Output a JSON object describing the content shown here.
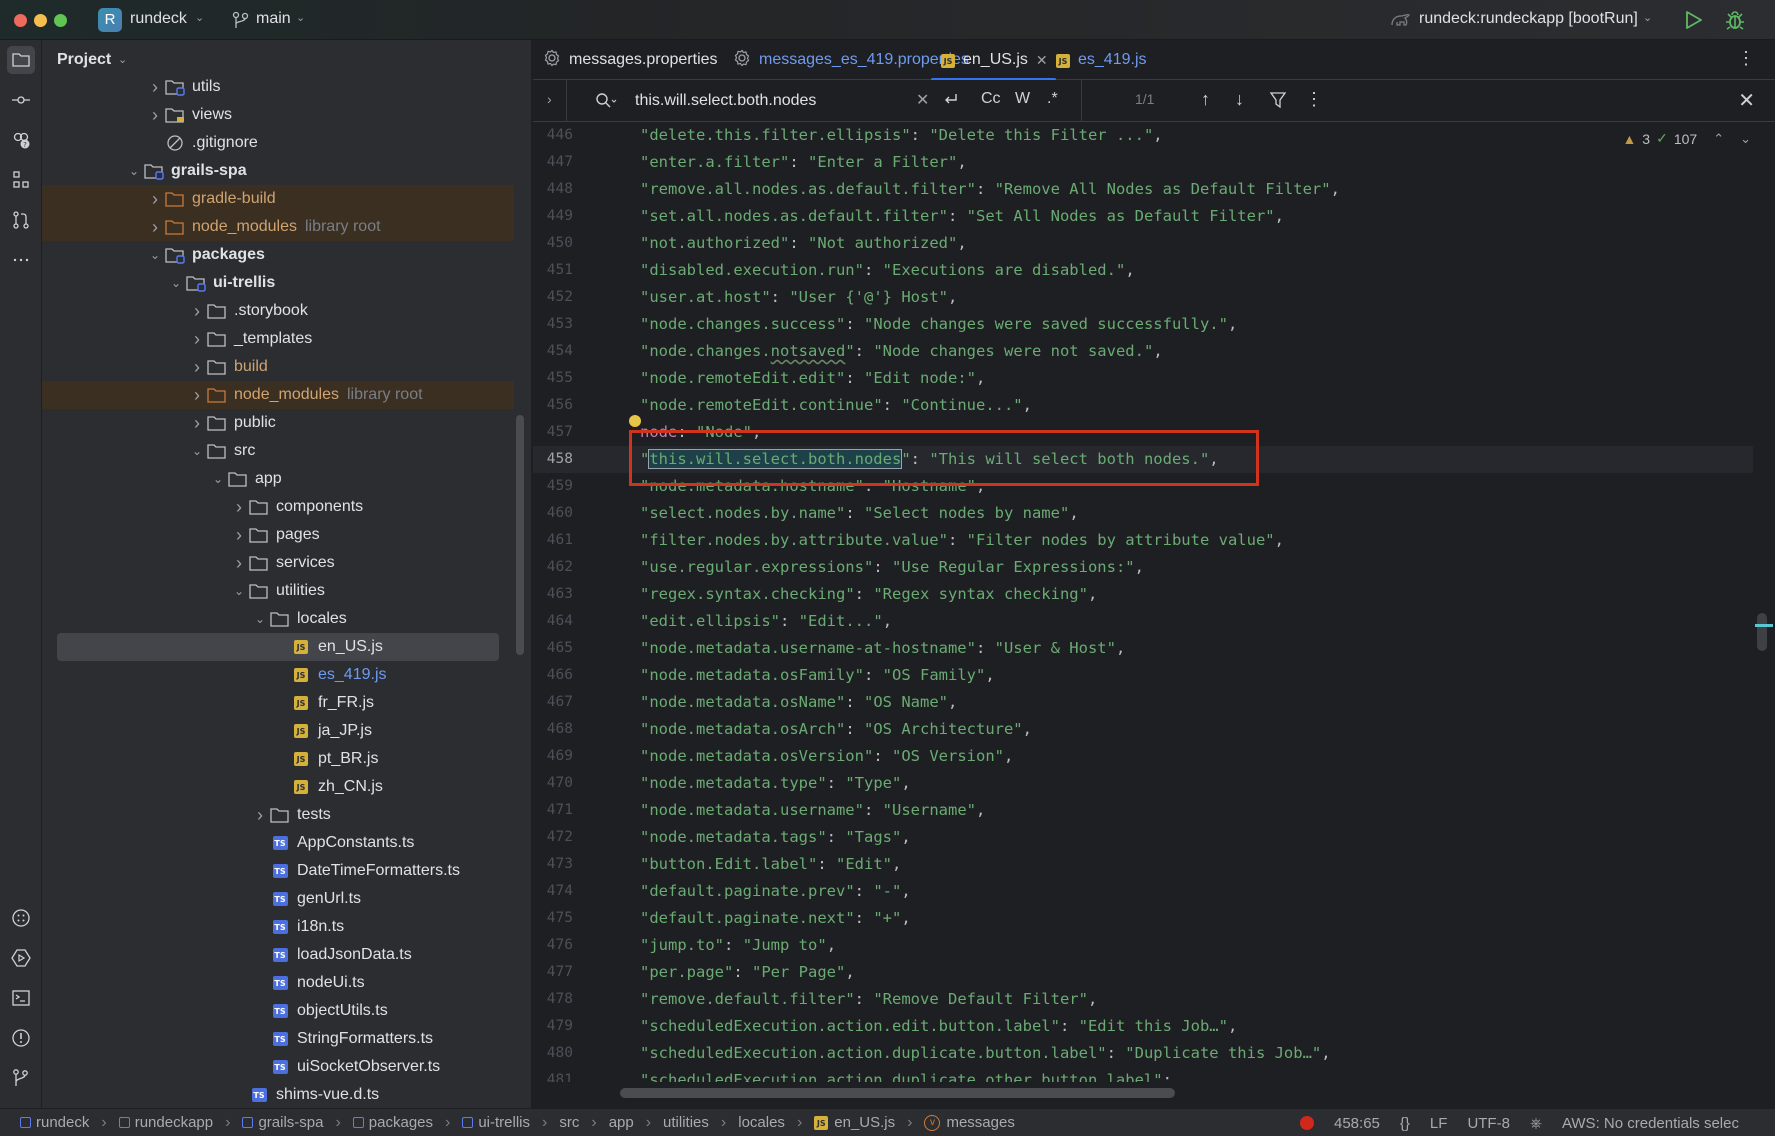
{
  "titlebar": {
    "project_initial": "R",
    "project_name": "rundeck",
    "branch": "main",
    "run_config": "rundeck:rundeckapp [bootRun]"
  },
  "colors": {
    "accent": "#3574f0",
    "string": "#6aab73",
    "highlight_box": "#d0341c",
    "library_root_bg": "#3a2f21",
    "run_green": "#5fb865"
  },
  "project_panel": {
    "title": "Project",
    "tree": [
      {
        "label": "utils",
        "indent": 4,
        "arrow": ">",
        "icon": "module-folder-icon",
        "style": ""
      },
      {
        "label": "views",
        "indent": 4,
        "arrow": ">",
        "icon": "views-folder-icon",
        "style": ""
      },
      {
        "label": ".gitignore",
        "indent": 4,
        "arrow": "",
        "icon": "ignore-file-icon",
        "style": ""
      },
      {
        "label": "grails-spa",
        "indent": 3,
        "arrow": "v",
        "icon": "module-folder-icon",
        "style": "bold"
      },
      {
        "label": "gradle-build",
        "indent": 4,
        "arrow": ">",
        "icon": "excluded-folder-icon",
        "style": "orange",
        "lib": true
      },
      {
        "label": "node_modules",
        "hint": "library root",
        "indent": 4,
        "arrow": ">",
        "icon": "excluded-folder-icon",
        "style": "orange",
        "lib": true
      },
      {
        "label": "packages",
        "indent": 4,
        "arrow": "v",
        "icon": "module-folder-icon",
        "style": "bold"
      },
      {
        "label": "ui-trellis",
        "indent": 5,
        "arrow": "v",
        "icon": "module-folder-icon",
        "style": "bold"
      },
      {
        "label": ".storybook",
        "indent": 6,
        "arrow": ">",
        "icon": "folder-icon",
        "style": ""
      },
      {
        "label": "_templates",
        "indent": 6,
        "arrow": ">",
        "icon": "folder-icon",
        "style": ""
      },
      {
        "label": "build",
        "indent": 6,
        "arrow": ">",
        "icon": "folder-icon",
        "style": "orange"
      },
      {
        "label": "node_modules",
        "hint": "library root",
        "indent": 6,
        "arrow": ">",
        "icon": "excluded-folder-icon",
        "style": "orange",
        "lib": true
      },
      {
        "label": "public",
        "indent": 6,
        "arrow": ">",
        "icon": "folder-icon",
        "style": ""
      },
      {
        "label": "src",
        "indent": 6,
        "arrow": "v",
        "icon": "folder-icon",
        "style": ""
      },
      {
        "label": "app",
        "indent": 7,
        "arrow": "v",
        "icon": "folder-icon",
        "style": ""
      },
      {
        "label": "components",
        "indent": 8,
        "arrow": ">",
        "icon": "folder-icon",
        "style": ""
      },
      {
        "label": "pages",
        "indent": 8,
        "arrow": ">",
        "icon": "folder-icon",
        "style": ""
      },
      {
        "label": "services",
        "indent": 8,
        "arrow": ">",
        "icon": "folder-icon",
        "style": ""
      },
      {
        "label": "utilities",
        "indent": 8,
        "arrow": "v",
        "icon": "folder-icon",
        "style": ""
      },
      {
        "label": "locales",
        "indent": 9,
        "arrow": "v",
        "icon": "folder-icon",
        "style": ""
      },
      {
        "label": "en_US.js",
        "indent": 10,
        "arrow": "",
        "icon": "js-file-icon",
        "style": "",
        "selected": true
      },
      {
        "label": "es_419.js",
        "indent": 10,
        "arrow": "",
        "icon": "js-file-icon",
        "style": "blue"
      },
      {
        "label": "fr_FR.js",
        "indent": 10,
        "arrow": "",
        "icon": "js-file-icon",
        "style": ""
      },
      {
        "label": "ja_JP.js",
        "indent": 10,
        "arrow": "",
        "icon": "js-file-icon",
        "style": ""
      },
      {
        "label": "pt_BR.js",
        "indent": 10,
        "arrow": "",
        "icon": "js-file-icon",
        "style": ""
      },
      {
        "label": "zh_CN.js",
        "indent": 10,
        "arrow": "",
        "icon": "js-file-icon",
        "style": ""
      },
      {
        "label": "tests",
        "indent": 9,
        "arrow": ">",
        "icon": "folder-icon",
        "style": ""
      },
      {
        "label": "AppConstants.ts",
        "indent": 9,
        "arrow": "",
        "icon": "ts-file-icon",
        "style": ""
      },
      {
        "label": "DateTimeFormatters.ts",
        "indent": 9,
        "arrow": "",
        "icon": "ts-file-icon",
        "style": ""
      },
      {
        "label": "genUrl.ts",
        "indent": 9,
        "arrow": "",
        "icon": "ts-file-icon",
        "style": ""
      },
      {
        "label": "i18n.ts",
        "indent": 9,
        "arrow": "",
        "icon": "ts-file-icon",
        "style": ""
      },
      {
        "label": "loadJsonData.ts",
        "indent": 9,
        "arrow": "",
        "icon": "ts-file-icon",
        "style": ""
      },
      {
        "label": "nodeUi.ts",
        "indent": 9,
        "arrow": "",
        "icon": "ts-file-icon",
        "style": ""
      },
      {
        "label": "objectUtils.ts",
        "indent": 9,
        "arrow": "",
        "icon": "ts-file-icon",
        "style": ""
      },
      {
        "label": "StringFormatters.ts",
        "indent": 9,
        "arrow": "",
        "icon": "ts-file-icon",
        "style": ""
      },
      {
        "label": "uiSocketObserver.ts",
        "indent": 9,
        "arrow": "",
        "icon": "ts-file-icon",
        "style": ""
      },
      {
        "label": "shims-vue.d.ts",
        "indent": 8,
        "arrow": "",
        "icon": "ts-file-icon",
        "style": ""
      }
    ]
  },
  "tabs": [
    {
      "label": "messages.properties",
      "icon": "gear-icon",
      "color": "normal",
      "active": false
    },
    {
      "label": "messages_es_419.properties",
      "icon": "gear-icon",
      "color": "blue",
      "active": false
    },
    {
      "label": "en_US.js",
      "icon": "js-file-icon",
      "color": "normal",
      "active": true,
      "closable": true
    },
    {
      "label": "es_419.js",
      "icon": "js-file-icon",
      "color": "blue",
      "active": false
    }
  ],
  "find": {
    "query": "this.will.select.both.nodes",
    "options": [
      "Cc",
      "W",
      ".*"
    ],
    "result_count": "1/1"
  },
  "inspections": {
    "warnings": "3",
    "ok": "107"
  },
  "code": {
    "current_line": 458,
    "lines": [
      {
        "n": 446,
        "key": "delete.this.filter.ellipsis",
        "value": "Delete this Filter ..."
      },
      {
        "n": 447,
        "key": "enter.a.filter",
        "value": "Enter a Filter"
      },
      {
        "n": 448,
        "key": "remove.all.nodes.as.default.filter",
        "value": "Remove All Nodes as Default Filter"
      },
      {
        "n": 449,
        "key": "set.all.nodes.as.default.filter",
        "value": "Set All Nodes as Default Filter"
      },
      {
        "n": 450,
        "key": "not.authorized",
        "value": "Not authorized"
      },
      {
        "n": 451,
        "key": "disabled.execution.run",
        "value": "Executions are disabled."
      },
      {
        "n": 452,
        "key": "user.at.host",
        "value": "User {'@'} Host"
      },
      {
        "n": 453,
        "key": "node.changes.success",
        "value": "Node changes were saved successfully."
      },
      {
        "n": 454,
        "key": "node.changes.notsaved",
        "value": "Node changes were not saved.",
        "typo": "notsaved"
      },
      {
        "n": 455,
        "key": "node.remoteEdit.edit",
        "value": "Edit node:"
      },
      {
        "n": 456,
        "key": "node.remoteEdit.continue",
        "value": "Continue..."
      },
      {
        "n": 457,
        "key": "node",
        "value": "Node",
        "unquoted": true
      },
      {
        "n": 458,
        "key": "this.will.select.both.nodes",
        "value": "This will select both nodes.",
        "match": true
      },
      {
        "n": 459,
        "key": "node.metadata.hostname",
        "value": "Hostname"
      },
      {
        "n": 460,
        "key": "select.nodes.by.name",
        "value": "Select nodes by name"
      },
      {
        "n": 461,
        "key": "filter.nodes.by.attribute.value",
        "value": "Filter nodes by attribute value"
      },
      {
        "n": 462,
        "key": "use.regular.expressions",
        "value": "Use Regular Expressions:"
      },
      {
        "n": 463,
        "key": "regex.syntax.checking",
        "value": "Regex syntax checking"
      },
      {
        "n": 464,
        "key": "edit.ellipsis",
        "value": "Edit..."
      },
      {
        "n": 465,
        "key": "node.metadata.username-at-hostname",
        "value": "User & Host"
      },
      {
        "n": 466,
        "key": "node.metadata.osFamily",
        "value": "OS Family"
      },
      {
        "n": 467,
        "key": "node.metadata.osName",
        "value": "OS Name"
      },
      {
        "n": 468,
        "key": "node.metadata.osArch",
        "value": "OS Architecture"
      },
      {
        "n": 469,
        "key": "node.metadata.osVersion",
        "value": "OS Version"
      },
      {
        "n": 470,
        "key": "node.metadata.type",
        "value": "Type"
      },
      {
        "n": 471,
        "key": "node.metadata.username",
        "value": "Username"
      },
      {
        "n": 472,
        "key": "node.metadata.tags",
        "value": "Tags"
      },
      {
        "n": 473,
        "key": "button.Edit.label",
        "value": "Edit"
      },
      {
        "n": 474,
        "key": "default.paginate.prev",
        "value": "-"
      },
      {
        "n": 475,
        "key": "default.paginate.next",
        "value": "+"
      },
      {
        "n": 476,
        "key": "jump.to",
        "value": "Jump to"
      },
      {
        "n": 477,
        "key": "per.page",
        "value": "Per Page"
      },
      {
        "n": 478,
        "key": "remove.default.filter",
        "value": "Remove Default Filter"
      },
      {
        "n": 479,
        "key": "scheduledExecution.action.edit.button.label",
        "value": "Edit this Job…"
      },
      {
        "n": 480,
        "key": "scheduledExecution.action.duplicate.button.label",
        "value": "Duplicate this Job…"
      },
      {
        "n": 481,
        "key": "scheduledExecution.action.duplicate.other.button.label",
        "value": null
      },
      {
        "n": 482,
        "key": null,
        "value": null
      }
    ]
  },
  "statusbar": {
    "breadcrumbs": [
      {
        "label": "rundeck",
        "icon": "module-icon"
      },
      {
        "label": "rundeckapp",
        "icon": "module-icon"
      },
      {
        "label": "grails-spa",
        "icon": "module-icon"
      },
      {
        "label": "packages",
        "icon": "module-icon"
      },
      {
        "label": "ui-trellis",
        "icon": "module-icon"
      },
      {
        "label": "src",
        "icon": ""
      },
      {
        "label": "app",
        "icon": ""
      },
      {
        "label": "utilities",
        "icon": ""
      },
      {
        "label": "locales",
        "icon": ""
      },
      {
        "label": "en_US.js",
        "icon": "js-file-icon"
      },
      {
        "label": "messages",
        "icon": "variable-icon"
      }
    ],
    "position": "458:65",
    "line_ending": "LF",
    "encoding": "UTF-8",
    "aws": "AWS: No credentials selec"
  }
}
